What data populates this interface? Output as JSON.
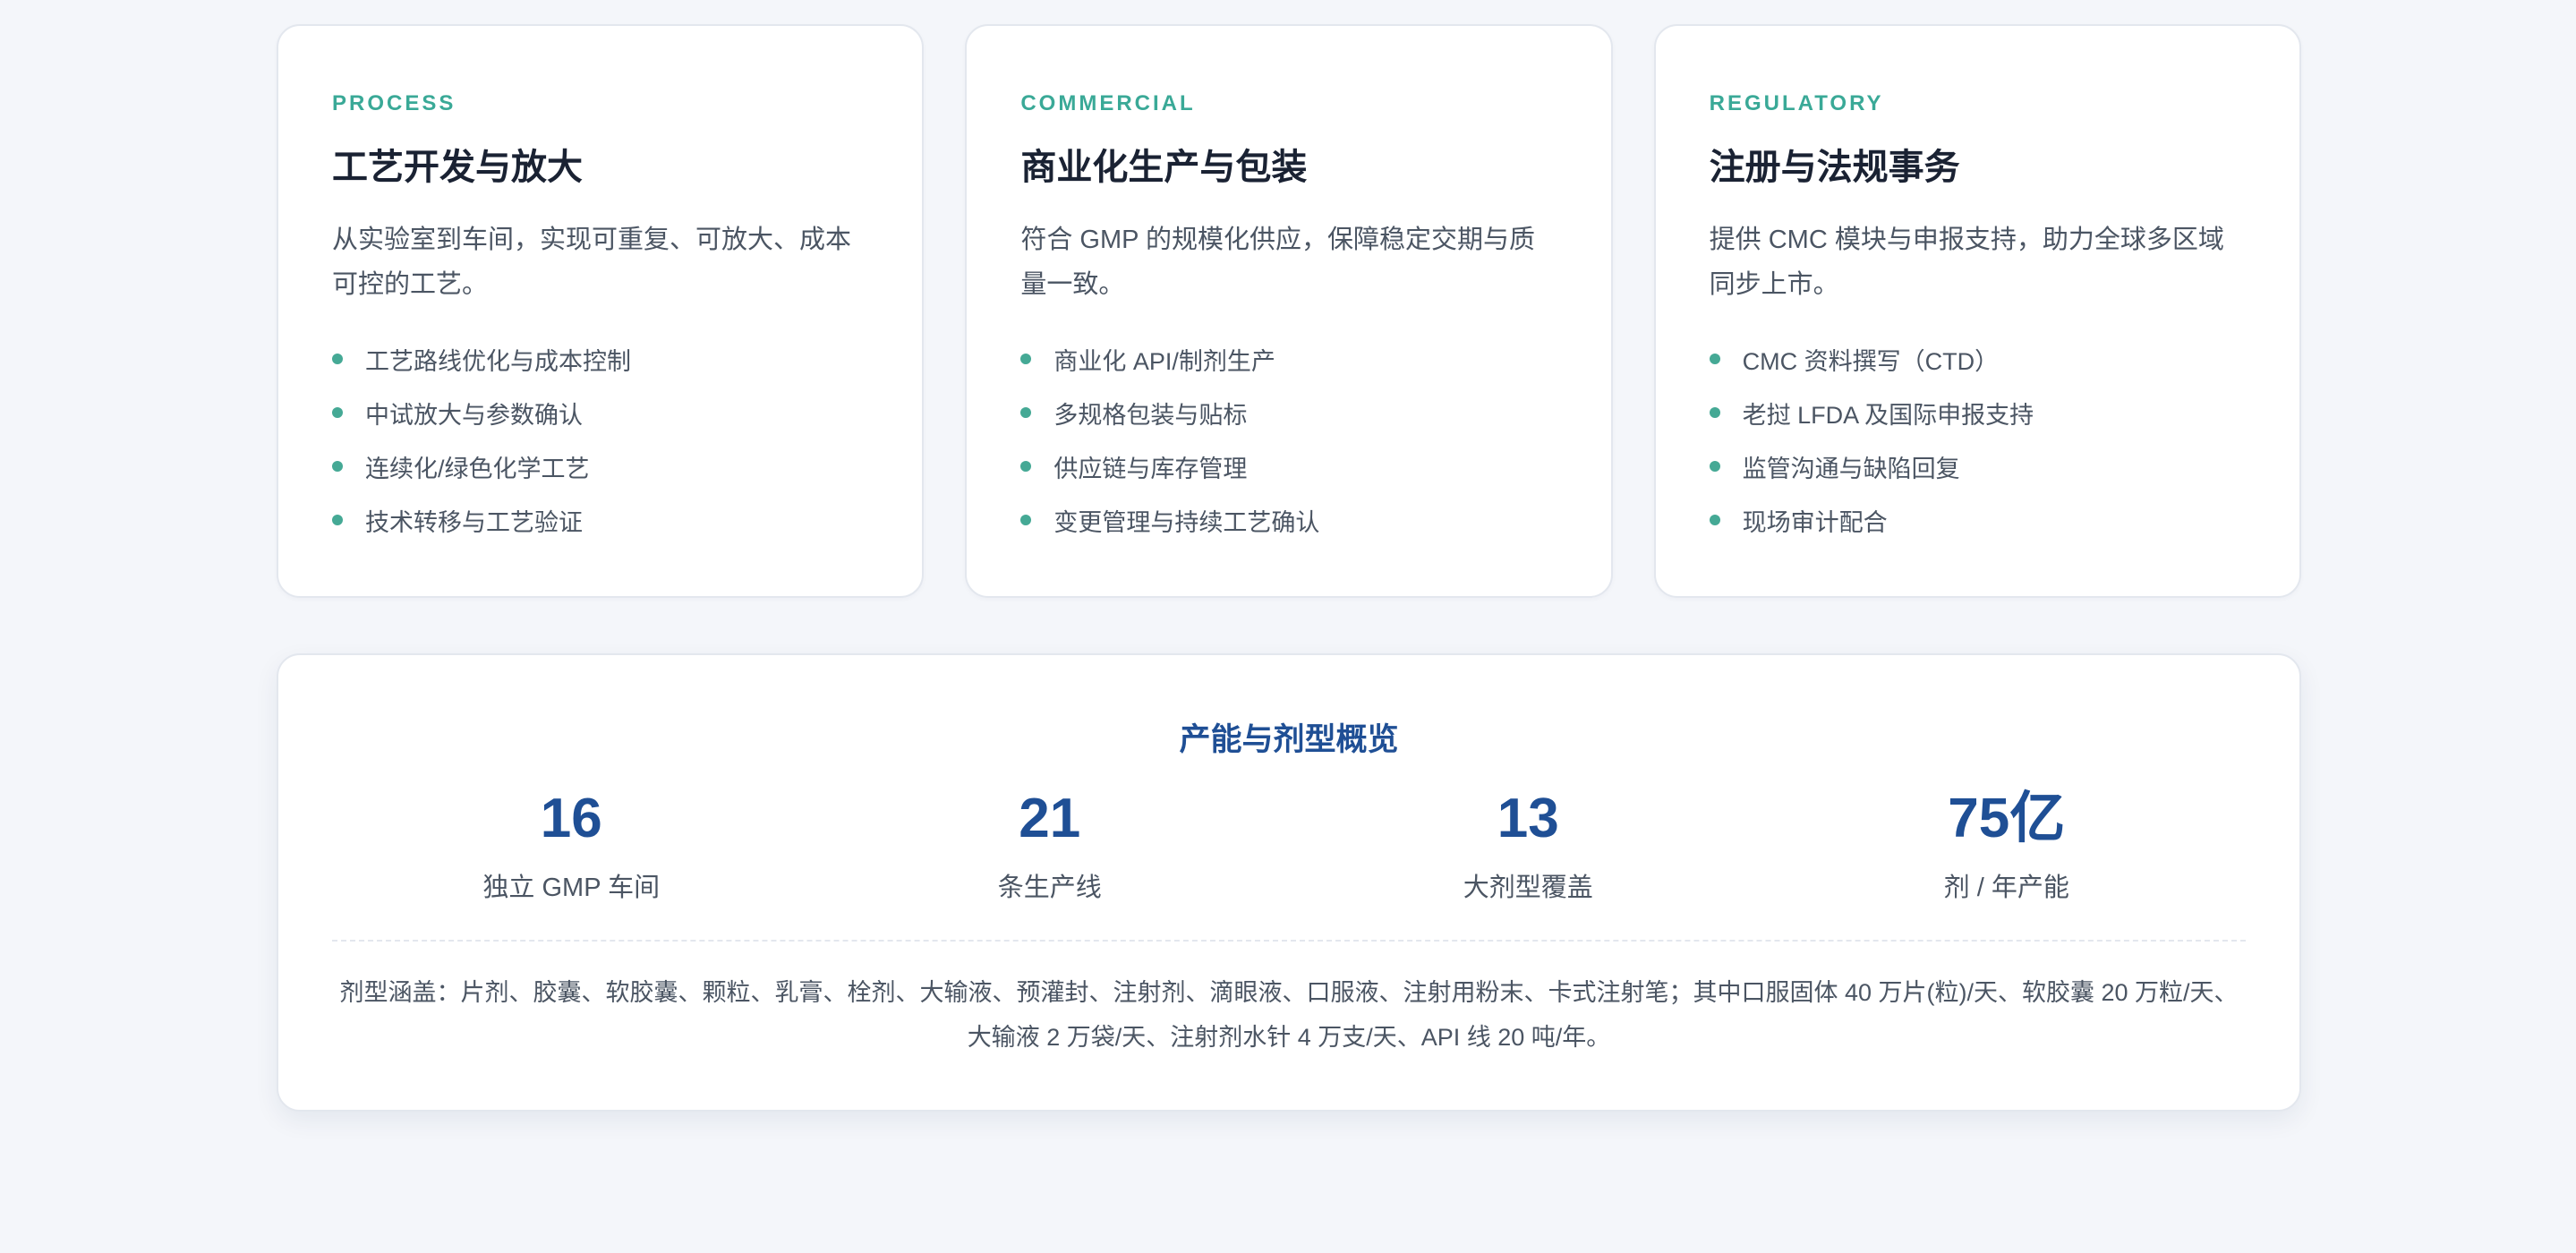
{
  "cards": [
    {
      "eyebrow": "PROCESS",
      "title": "工艺开发与放大",
      "desc": "从实验室到车间，实现可重复、可放大、成本可控的工艺。",
      "bullets": [
        "工艺路线优化与成本控制",
        "中试放大与参数确认",
        "连续化/绿色化学工艺",
        "技术转移与工艺验证"
      ]
    },
    {
      "eyebrow": "COMMERCIAL",
      "title": "商业化生产与包装",
      "desc": "符合 GMP 的规模化供应，保障稳定交期与质量一致。",
      "bullets": [
        "商业化 API/制剂生产",
        "多规格包装与贴标",
        "供应链与库存管理",
        "变更管理与持续工艺确认"
      ]
    },
    {
      "eyebrow": "REGULATORY",
      "title": "注册与法规事务",
      "desc": "提供 CMC 模块与申报支持，助力全球多区域同步上市。",
      "bullets": [
        "CMC 资料撰写（CTD）",
        "老挝 LFDA 及国际申报支持",
        "监管沟通与缺陷回复",
        "现场审计配合"
      ]
    }
  ],
  "overview": {
    "title": "产能与剂型概览",
    "stats": [
      {
        "value": "16",
        "label": "独立 GMP 车间"
      },
      {
        "value": "21",
        "label": "条生产线"
      },
      {
        "value": "13",
        "label": "大剂型覆盖"
      },
      {
        "value": "75亿",
        "label": "剂 / 年产能"
      }
    ],
    "note_line1": "剂型涵盖：片剂、胶囊、软胶囊、颗粒、乳膏、栓剂、大输液、预灌封、注射剂、滴眼液、口服液、注射用粉末、卡式注射笔；其中口服固体 40 万片(粒)/天、软胶囊 20 万粒/天、",
    "note_line2": "大输液 2 万袋/天、注射剂水针 4 万支/天、API 线 20 吨/年。"
  },
  "colors": {
    "accent_teal": "#3aa997",
    "accent_blue": "#1f4f95",
    "background": "#f4f6fa"
  }
}
